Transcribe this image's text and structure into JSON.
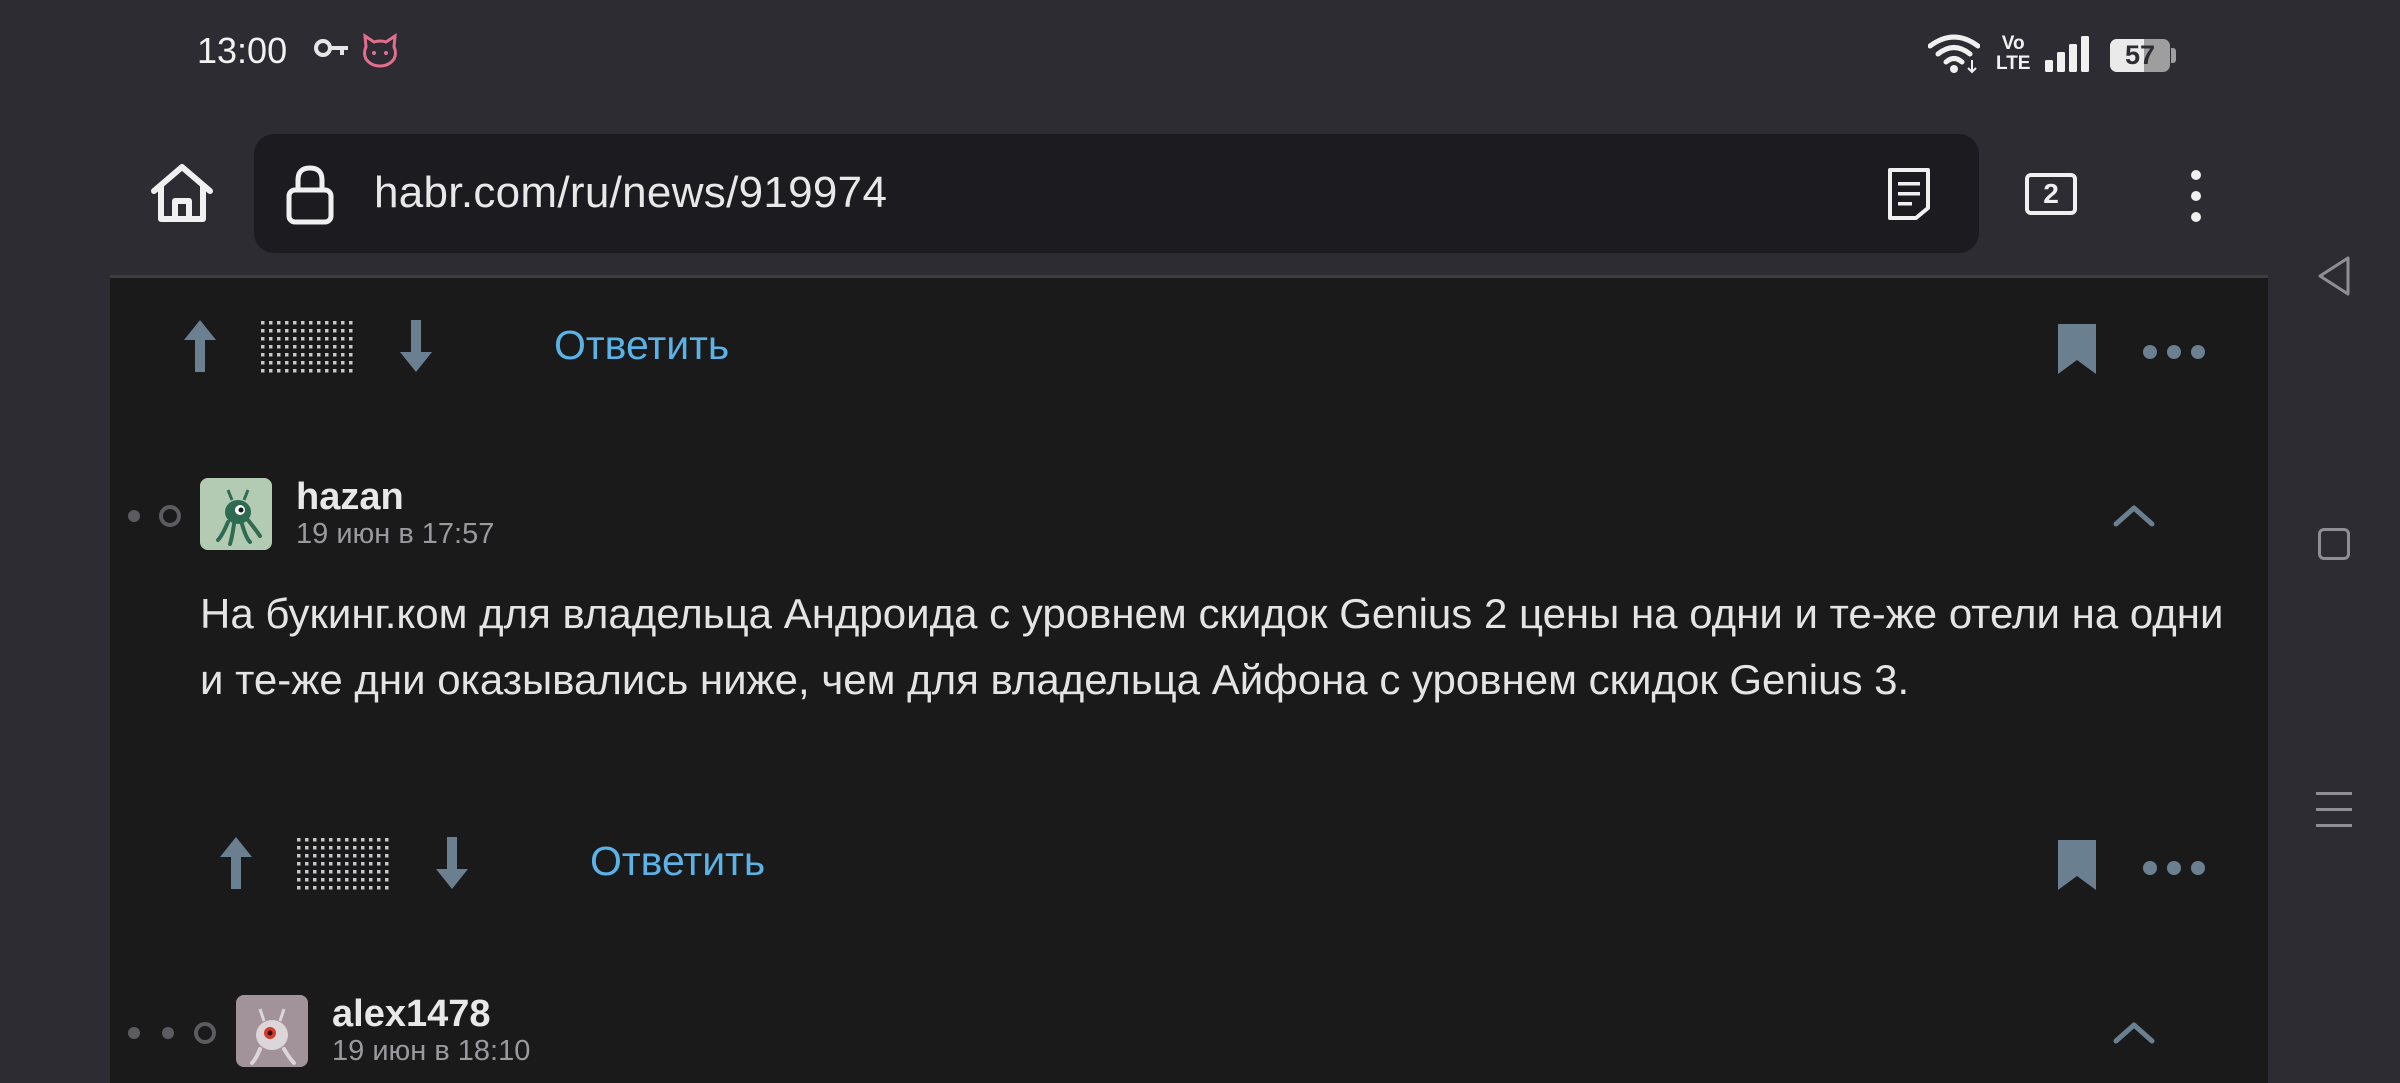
{
  "status_bar": {
    "time": "13:00",
    "volte_top": "Vo",
    "volte_bottom": "LTE",
    "battery": "57",
    "battery_level_percent": 57,
    "icons": [
      "key-icon",
      "cat-icon",
      "wifi-icon",
      "volte-icon",
      "signal-icon",
      "battery-icon"
    ]
  },
  "browser": {
    "url": "habr.com/ru/news/919974",
    "tab_count": "2",
    "icons": [
      "home-icon",
      "lock-icon",
      "reader-mode-icon",
      "tabs-icon",
      "menu-icon"
    ]
  },
  "comments": [
    {
      "reply_label": "Ответить"
    },
    {
      "username": "hazan",
      "time": "19 июн в 17:57",
      "body": "На букинг.ком для владельца Андроида с уровнем скидок Genius 2 цены на одни и те-же отели на одни и те-же дни оказывались ниже, чем для владельца Айфона с уровнем скидок Genius 3.",
      "reply_label": "Ответить"
    },
    {
      "username": "alex1478",
      "time": "19 июн в 18:10"
    }
  ],
  "nav_bar": {
    "icons": [
      "back-icon",
      "home-square-icon",
      "recents-icon"
    ]
  },
  "colors": {
    "background": "#2d2c33",
    "page": "#1a1a1b",
    "url_bar": "#1c1b20",
    "link": "#5bb2e6",
    "vote_icons": "#6a8090"
  }
}
